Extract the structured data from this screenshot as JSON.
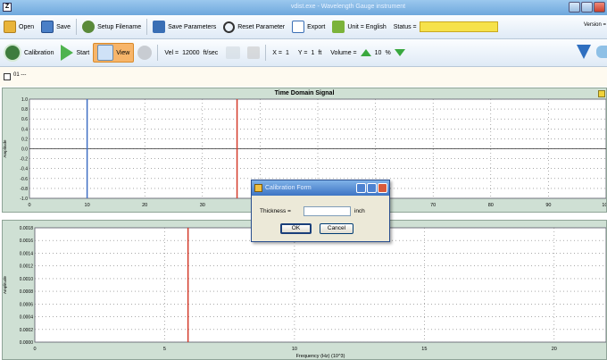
{
  "window": {
    "title": "vdist.exe - Wavelength Gauge instrument"
  },
  "toolbar1": {
    "open": "Open",
    "save": "Save",
    "setup_filename": "Setup Filename",
    "save_parameters": "Save Parameters",
    "reset_parameter": "Reset Parameter",
    "export": "Export",
    "unit": "Unit = English",
    "status_label": "Status =",
    "status_value": "",
    "version": "Version ="
  },
  "toolbar2": {
    "calibration": "Calibration",
    "start": "Start",
    "view": "View",
    "vel_label": "Vel =",
    "vel_value": "12000",
    "vel_unit": "ft/sec",
    "x_label": "X =",
    "x_value": "1",
    "y_label": "Y =",
    "y_value": "1",
    "y_unit": "ft",
    "volume_label": "Volume =",
    "volume_value": "10",
    "volume_unit": "%"
  },
  "subbar": {
    "tab_label": "01 ---"
  },
  "top_panel": {
    "title": "Time Domain Signal"
  },
  "bottom_panel": {
    "xlabel": "Frequency (Hz) (10^3)"
  },
  "dialog": {
    "title": "Calibration Form",
    "thickness_label": "Thickness =",
    "thickness_value": "",
    "thickness_unit": "inch",
    "ok": "OK",
    "cancel": "Cancel"
  },
  "colors": {
    "panel_bg": "#cfe0d4",
    "status_yellow": "#f6e24a",
    "marker_red": "#d43b2b",
    "marker_blue": "#3f6fc4",
    "accent_green": "#39a83e"
  },
  "chart_data": [
    {
      "type": "line",
      "title": "Time Domain Signal",
      "xlabel": "",
      "ylabel": "Amplitude",
      "xlim": [
        0,
        100
      ],
      "ylim": [
        -1.0,
        1.0
      ],
      "x_ticks": [
        0,
        10,
        20,
        30,
        40,
        50,
        60,
        70,
        80,
        90,
        100
      ],
      "y_ticks": [
        1.0,
        0.8,
        0.6,
        0.4,
        0.2,
        0.0,
        -0.2,
        -0.4,
        -0.6,
        -0.8,
        -1.0
      ],
      "grid": true,
      "series": [
        {
          "values": []
        }
      ],
      "markers": [
        {
          "x": 10,
          "color": "#3f6fc4"
        },
        {
          "x": 36,
          "color": "#d43b2b"
        }
      ]
    },
    {
      "type": "line",
      "title": "",
      "xlabel": "Frequency (Hz) (10^3)",
      "ylabel": "Amplitude",
      "xlim": [
        0,
        22
      ],
      "ylim": [
        0,
        0.0018
      ],
      "x_ticks": [
        0,
        5,
        10,
        15,
        20
      ],
      "y_ticks": [
        0.0018,
        0.0016,
        0.0014,
        0.0012,
        0.001,
        0.0008,
        0.0006,
        0.0004,
        0.0002,
        0.0
      ],
      "grid": true,
      "series": [
        {
          "values": []
        }
      ],
      "markers": [
        {
          "x": 5.9,
          "color": "#d43b2b"
        }
      ]
    }
  ]
}
